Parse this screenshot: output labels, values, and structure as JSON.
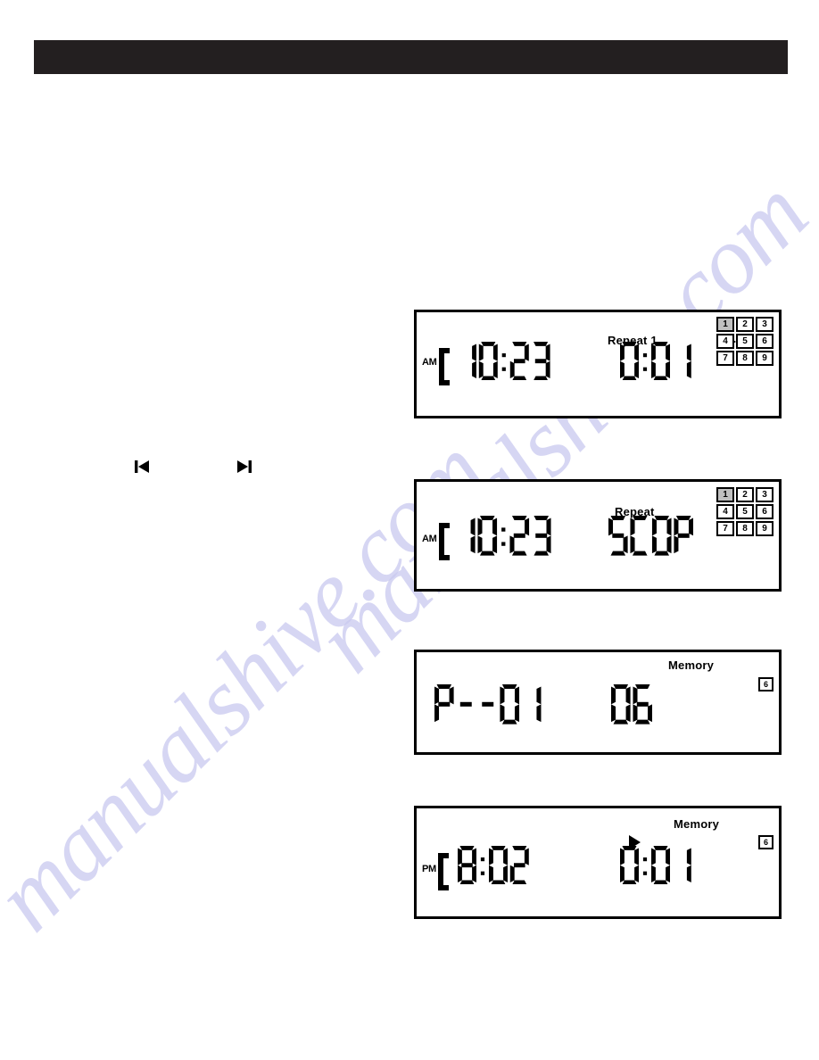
{
  "page": {
    "banner": {
      "label": "",
      "color": "#231f20"
    }
  },
  "watermark": {
    "text": "manualshive.com",
    "color": "#c9c9ef"
  },
  "transport": {
    "buttons": [
      {
        "name": "skip-back-icon",
        "label": "⏮"
      },
      {
        "name": "skip-forward-icon",
        "label": "⏭"
      }
    ]
  },
  "panels": [
    {
      "id": "display-repeat-one-playing",
      "status_word": "Repeat 1",
      "show_play": true,
      "ampm": "AM",
      "clock": "10:23",
      "readout": "0:01",
      "readout_kind": "digits",
      "grid": {
        "type": "track-grid",
        "cells": [
          "1",
          "2",
          "3",
          "4",
          "5",
          "6",
          "7",
          "8",
          "9"
        ],
        "active": "1"
      }
    },
    {
      "id": "display-repeat-stop",
      "status_word": "Repeat",
      "show_play": false,
      "ampm": "AM",
      "clock": "10:23",
      "readout": "STOP",
      "readout_kind": "word",
      "grid": {
        "type": "track-grid",
        "cells": [
          "1",
          "2",
          "3",
          "4",
          "5",
          "6",
          "7",
          "8",
          "9"
        ],
        "active": "1"
      }
    },
    {
      "id": "display-memory-program",
      "status_word": "Memory",
      "show_play": false,
      "ampm": "",
      "clock": "P--01",
      "readout": "06",
      "readout_kind": "digits",
      "grid": {
        "type": "memory-box",
        "cells": [
          "6"
        ],
        "active": "6"
      }
    },
    {
      "id": "display-memory-playing",
      "status_word": "Memory",
      "show_play": true,
      "ampm": "PM",
      "clock": "8:02",
      "readout": "0:01",
      "readout_kind": "digits",
      "grid": {
        "type": "memory-box",
        "cells": [
          "6"
        ],
        "active": "6"
      }
    }
  ]
}
